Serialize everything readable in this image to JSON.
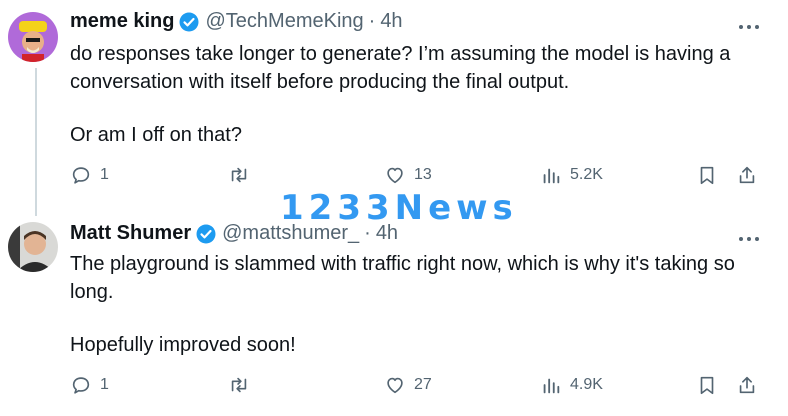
{
  "tweets": [
    {
      "name": "meme king",
      "handle": "@TechMemeKing",
      "time": "4h",
      "paragraphs": [
        "do responses take longer to generate? I’m assuming the model is having a conversation with itself before producing the final output.",
        "Or am I off on that?"
      ],
      "replies": "1",
      "retweets": "",
      "likes": "13",
      "views": "5.2K"
    },
    {
      "name": "Matt Shumer",
      "handle": "@mattshumer_",
      "time": "4h",
      "paragraphs": [
        "The playground is slammed with traffic right now, which is why it's taking so long.",
        "Hopefully improved soon!"
      ],
      "replies": "1",
      "retweets": "",
      "likes": "27",
      "views": "4.9K"
    }
  ],
  "separator": "·",
  "watermark": "1233News",
  "icons": [
    "verified-badge-icon",
    "more-icon",
    "reply-icon",
    "retweet-icon",
    "like-icon",
    "views-icon",
    "bookmark-icon",
    "share-icon"
  ],
  "colors": {
    "verified": "#1d9bf0",
    "muted": "#536471",
    "watermark": "#1d8ff0"
  }
}
